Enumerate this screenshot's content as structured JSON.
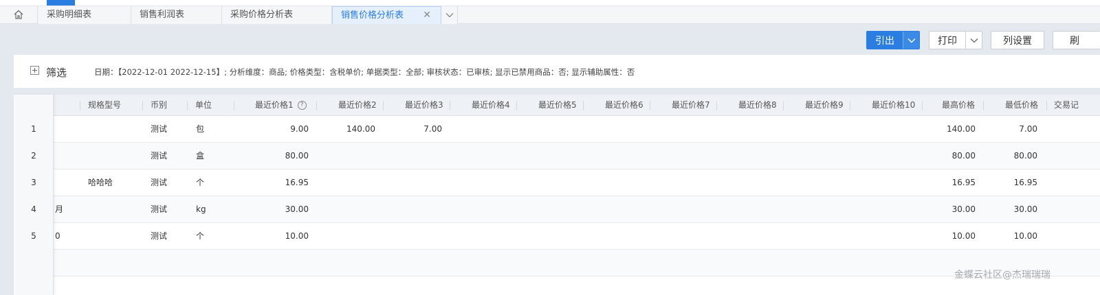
{
  "tabs": [
    {
      "label": "采购明细表"
    },
    {
      "label": "销售利润表"
    },
    {
      "label": "采购价格分析表"
    },
    {
      "label": "销售价格分析表",
      "active": true,
      "close": "✕"
    }
  ],
  "toolbar": {
    "export_label": "引出",
    "print_label": "打印",
    "columns_label": "列设置",
    "refresh_label": "刷"
  },
  "filter": {
    "title": "筛选",
    "summary": "日期：【2022-12-01 2022-12-15】; 分析维度：商品; 价格类型：含税单价; 单据类型：全部; 审核状态：已审核; 显示已禁用商品：否; 显示辅助属性：否"
  },
  "table": {
    "headers": {
      "spec": "规格型号",
      "currency": "币别",
      "unit": "单位",
      "p1": "最近价格1",
      "p2": "最近价格2",
      "p3": "最近价格3",
      "p4": "最近价格4",
      "p5": "最近价格5",
      "p6": "最近价格6",
      "p7": "最近价格7",
      "p8": "最近价格8",
      "p9": "最近价格9",
      "p10": "最近价格10",
      "max": "最高价格",
      "min": "最低价格",
      "record": "交易记"
    },
    "help_glyph": "?",
    "rows": [
      {
        "num": "1",
        "name": "",
        "spec": "",
        "currency": "测试",
        "unit": "包",
        "p1": "9.00",
        "p2": "140.00",
        "p3": "7.00",
        "max": "140.00",
        "min": "7.00"
      },
      {
        "num": "2",
        "name": "",
        "spec": "",
        "currency": "测试",
        "unit": "盒",
        "p1": "80.00",
        "p2": "",
        "p3": "",
        "max": "80.00",
        "min": "80.00"
      },
      {
        "num": "3",
        "name": "",
        "spec": "哈哈哈",
        "currency": "测试",
        "unit": "个",
        "p1": "16.95",
        "p2": "",
        "p3": "",
        "max": "16.95",
        "min": "16.95"
      },
      {
        "num": "4",
        "name": "月",
        "spec": "",
        "currency": "测试",
        "unit": "kg",
        "p1": "30.00",
        "p2": "",
        "p3": "",
        "max": "30.00",
        "min": "30.00"
      },
      {
        "num": "5",
        "name": "0",
        "spec": "",
        "currency": "测试",
        "unit": "个",
        "p1": "10.00",
        "p2": "",
        "p3": "",
        "max": "10.00",
        "min": "10.00"
      }
    ]
  },
  "watermark": "金蝶云社区@杰瑞瑞瑞",
  "colors": {
    "accent": "#2a7de1"
  }
}
